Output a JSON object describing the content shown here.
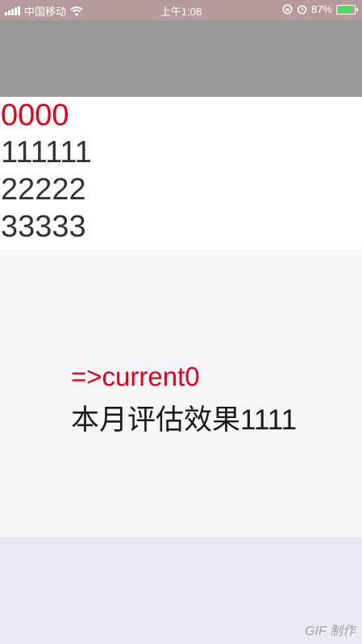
{
  "status_bar": {
    "carrier": "中国移动",
    "time": "上午1:08",
    "battery_text": "87%",
    "battery_level": 0.87,
    "signal_icon": "signal-bars-icon",
    "wifi_icon": "wifi-icon",
    "rotation_lock_icon": "rotation-lock-icon",
    "alarm_icon": "alarm-icon",
    "battery_icon": "battery-icon"
  },
  "list": {
    "items": [
      {
        "label": "0000",
        "selected": true
      },
      {
        "label": "111111",
        "selected": false
      },
      {
        "label": "22222",
        "selected": false
      },
      {
        "label": "33333",
        "selected": false
      }
    ]
  },
  "detail": {
    "current_label": "=>current0",
    "description": "本月评估效果1111"
  },
  "watermark": "GIF 制作",
  "colors": {
    "status_bar_bg": "#b79a9c",
    "nav_bg": "#999999",
    "selected_text": "#e8001a",
    "normal_text": "#333333",
    "detail_bg": "#f6f6f9",
    "battery_fill": "#4cd964"
  }
}
